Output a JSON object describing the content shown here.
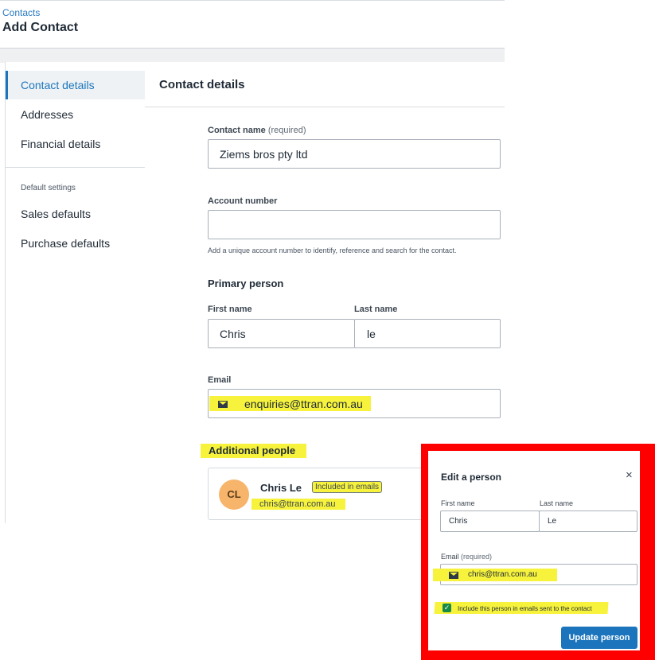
{
  "header": {
    "breadcrumb": "Contacts",
    "title": "Add Contact"
  },
  "sidebar": {
    "items": [
      {
        "label": "Contact details",
        "active": true
      },
      {
        "label": "Addresses"
      },
      {
        "label": "Financial details"
      }
    ],
    "section_label": "Default settings",
    "settings_items": [
      {
        "label": "Sales defaults"
      },
      {
        "label": "Purchase defaults"
      }
    ]
  },
  "main": {
    "title": "Contact details",
    "contact_name": {
      "label": "Contact name",
      "required": "(required)",
      "value": "Ziems bros pty ltd"
    },
    "account_number": {
      "label": "Account number",
      "value": "",
      "hint": "Add a unique account number to identify, reference and search for the contact."
    },
    "primary_person": {
      "title": "Primary person",
      "first_name_label": "First name",
      "first_name": "Chris",
      "last_name_label": "Last name",
      "last_name": "le"
    },
    "email": {
      "label": "Email",
      "value": "enquiries@ttran.com.au",
      "icon": "envelope-icon"
    },
    "additional_people": {
      "title": "Additional people",
      "people": [
        {
          "initials": "CL",
          "name": "Chris Le",
          "tag": "Included in emails",
          "email": "chris@ttran.com.au"
        }
      ]
    }
  },
  "modal": {
    "title": "Edit a person",
    "close": "×",
    "first_name_label": "First name",
    "first_name": "Chris",
    "last_name_label": "Last name",
    "last_name": "Le",
    "email_label": "Email",
    "email_required": "(required)",
    "email": "chris@ttran.com.au",
    "checkbox_label": "Include this person in emails sent to the contact",
    "checkbox_checked": true,
    "submit_label": "Update person"
  },
  "colors": {
    "accent": "#1c75bc",
    "highlight": "#f7f33c",
    "frame": "#ff0000",
    "check": "#168a46",
    "avatar": "#f7b56b"
  }
}
